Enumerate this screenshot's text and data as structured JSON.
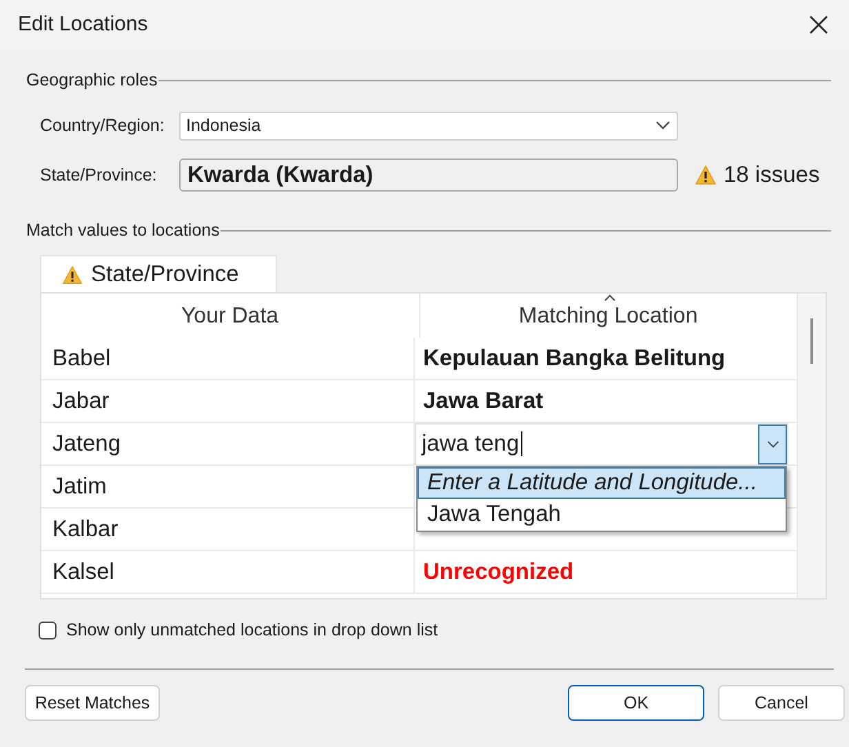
{
  "window": {
    "title": "Edit Locations"
  },
  "geographic_roles": {
    "title": "Geographic roles",
    "country": {
      "label": "Country/Region:",
      "value": "Indonesia"
    },
    "state": {
      "label": "State/Province:",
      "value": "Kwarda (Kwarda)",
      "issues": "18 issues"
    }
  },
  "match_section": {
    "title": "Match values to locations",
    "tabs": [
      {
        "label": "State/Province",
        "selected": true,
        "warning": true
      }
    ],
    "table": {
      "columns": [
        "Your Data",
        "Matching Location"
      ],
      "rows": [
        {
          "your_data": "Babel",
          "kind": "matched",
          "match": "Kepulauan Bangka Belitung"
        },
        {
          "your_data": "Jabar",
          "kind": "matched",
          "match": "Jawa Barat"
        },
        {
          "your_data": "Jateng",
          "kind": "editing",
          "match": "jawa teng"
        },
        {
          "your_data": "Jatim",
          "kind": "hidden"
        },
        {
          "your_data": "Kalbar",
          "kind": "hidden"
        },
        {
          "your_data": "Kalsel",
          "kind": "unrecognized",
          "match": "Unrecognized"
        }
      ]
    },
    "dropdown": {
      "items": [
        {
          "label": "Enter a Latitude and Longitude...",
          "kind": "action",
          "selected": true
        },
        {
          "label": "Jawa Tengah",
          "kind": "location",
          "selected": false
        }
      ]
    }
  },
  "unmatched_only": {
    "label": "Show only unmatched locations in drop down list",
    "checked": false
  },
  "buttons": [
    {
      "label": "Reset Matches",
      "default": false
    },
    {
      "label": "OK",
      "default": true
    },
    {
      "label": "Cancel",
      "default": false
    }
  ]
}
